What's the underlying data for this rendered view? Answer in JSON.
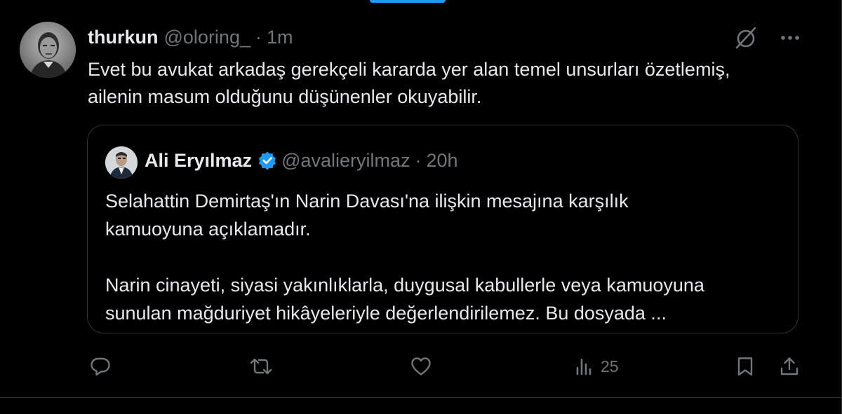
{
  "tweet": {
    "author": {
      "display_name": "thurkun",
      "handle": "@oloring_",
      "time": "1m"
    },
    "separator": "·",
    "text": "Evet bu avukat arkadaş gerekçeli kararda yer alan temel unsurları özetlemiş,\nailenin masum olduğunu düşünenler okuyabilir.",
    "header_icons": [
      "grok-icon",
      "more-icon"
    ]
  },
  "quoted_tweet": {
    "author": {
      "display_name": "Ali Eryılmaz",
      "handle": "@avalieryilmaz",
      "time": "20h",
      "verified": true
    },
    "separator": "·",
    "text": "Selahattin Demirtaş'ın Narin Davası'na ilişkin mesajına karşılık\nkamuoyuna açıklamadır.\n\nNarin cinayeti, siyasi yakınlıklarla, duygusal kabullerle veya kamuoyuna\nsunulan mağduriyet hikâyeleriyle değerlendirilemez. Bu dosyada ..."
  },
  "actions": {
    "views_count": "25",
    "icons": [
      "reply-icon",
      "retweet-icon",
      "like-icon",
      "views-icon",
      "bookmark-icon",
      "share-icon"
    ]
  },
  "colors": {
    "background": "#000000",
    "text_primary": "#e7e9ea",
    "text_secondary": "#71767b",
    "border": "#2f3336",
    "verified_blue": "#1d9bf0"
  }
}
